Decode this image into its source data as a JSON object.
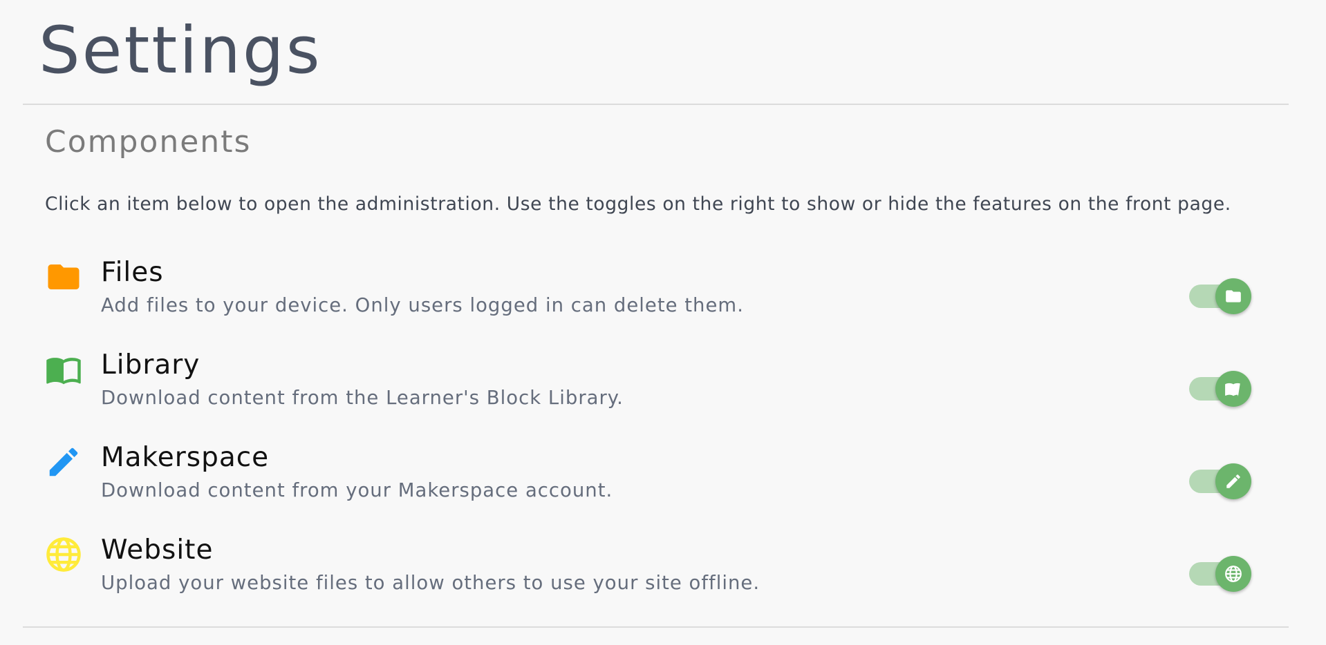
{
  "page": {
    "title": "Settings"
  },
  "section": {
    "title": "Components",
    "intro": "Click an item below to open the administration. Use the toggles on the right to show or hide the features on the front page."
  },
  "components": [
    {
      "name": "Files",
      "description": "Add files to your device. Only users logged in can delete them.",
      "icon": "folder-icon",
      "icon_color": "#ff9800",
      "enabled": true
    },
    {
      "name": "Library",
      "description": "Download content from the Learner's Block Library.",
      "icon": "book-icon",
      "icon_color": "#4caf50",
      "enabled": true
    },
    {
      "name": "Makerspace",
      "description": "Download content from your Makerspace account.",
      "icon": "pencil-icon",
      "icon_color": "#2196f3",
      "enabled": true
    },
    {
      "name": "Website",
      "description": "Upload your website files to allow others to use your site offline.",
      "icon": "globe-icon",
      "icon_color": "#ffeb3b",
      "enabled": true
    }
  ],
  "colors": {
    "toggle_track_on": "#b5d8b5",
    "toggle_knob_on": "#6cb56c",
    "title": "#4a5262"
  }
}
